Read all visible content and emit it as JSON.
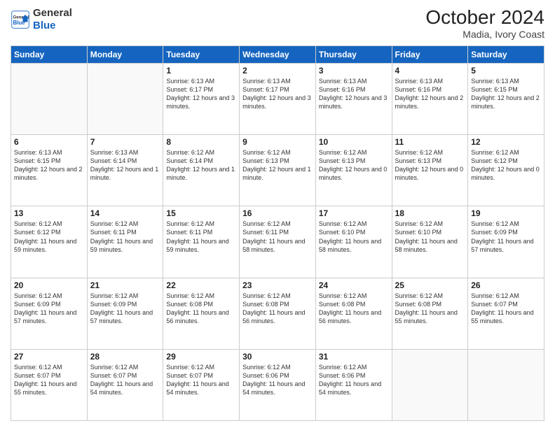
{
  "logo": {
    "general": "General",
    "blue": "Blue"
  },
  "header": {
    "month": "October 2024",
    "location": "Madia, Ivory Coast"
  },
  "days_header": [
    "Sunday",
    "Monday",
    "Tuesday",
    "Wednesday",
    "Thursday",
    "Friday",
    "Saturday"
  ],
  "weeks": [
    [
      {
        "day": "",
        "info": ""
      },
      {
        "day": "",
        "info": ""
      },
      {
        "day": "1",
        "info": "Sunrise: 6:13 AM\nSunset: 6:17 PM\nDaylight: 12 hours and 3 minutes."
      },
      {
        "day": "2",
        "info": "Sunrise: 6:13 AM\nSunset: 6:17 PM\nDaylight: 12 hours and 3 minutes."
      },
      {
        "day": "3",
        "info": "Sunrise: 6:13 AM\nSunset: 6:16 PM\nDaylight: 12 hours and 3 minutes."
      },
      {
        "day": "4",
        "info": "Sunrise: 6:13 AM\nSunset: 6:16 PM\nDaylight: 12 hours and 2 minutes."
      },
      {
        "day": "5",
        "info": "Sunrise: 6:13 AM\nSunset: 6:15 PM\nDaylight: 12 hours and 2 minutes."
      }
    ],
    [
      {
        "day": "6",
        "info": "Sunrise: 6:13 AM\nSunset: 6:15 PM\nDaylight: 12 hours and 2 minutes."
      },
      {
        "day": "7",
        "info": "Sunrise: 6:13 AM\nSunset: 6:14 PM\nDaylight: 12 hours and 1 minute."
      },
      {
        "day": "8",
        "info": "Sunrise: 6:12 AM\nSunset: 6:14 PM\nDaylight: 12 hours and 1 minute."
      },
      {
        "day": "9",
        "info": "Sunrise: 6:12 AM\nSunset: 6:13 PM\nDaylight: 12 hours and 1 minute."
      },
      {
        "day": "10",
        "info": "Sunrise: 6:12 AM\nSunset: 6:13 PM\nDaylight: 12 hours and 0 minutes."
      },
      {
        "day": "11",
        "info": "Sunrise: 6:12 AM\nSunset: 6:13 PM\nDaylight: 12 hours and 0 minutes."
      },
      {
        "day": "12",
        "info": "Sunrise: 6:12 AM\nSunset: 6:12 PM\nDaylight: 12 hours and 0 minutes."
      }
    ],
    [
      {
        "day": "13",
        "info": "Sunrise: 6:12 AM\nSunset: 6:12 PM\nDaylight: 11 hours and 59 minutes."
      },
      {
        "day": "14",
        "info": "Sunrise: 6:12 AM\nSunset: 6:11 PM\nDaylight: 11 hours and 59 minutes."
      },
      {
        "day": "15",
        "info": "Sunrise: 6:12 AM\nSunset: 6:11 PM\nDaylight: 11 hours and 59 minutes."
      },
      {
        "day": "16",
        "info": "Sunrise: 6:12 AM\nSunset: 6:11 PM\nDaylight: 11 hours and 58 minutes."
      },
      {
        "day": "17",
        "info": "Sunrise: 6:12 AM\nSunset: 6:10 PM\nDaylight: 11 hours and 58 minutes."
      },
      {
        "day": "18",
        "info": "Sunrise: 6:12 AM\nSunset: 6:10 PM\nDaylight: 11 hours and 58 minutes."
      },
      {
        "day": "19",
        "info": "Sunrise: 6:12 AM\nSunset: 6:09 PM\nDaylight: 11 hours and 57 minutes."
      }
    ],
    [
      {
        "day": "20",
        "info": "Sunrise: 6:12 AM\nSunset: 6:09 PM\nDaylight: 11 hours and 57 minutes."
      },
      {
        "day": "21",
        "info": "Sunrise: 6:12 AM\nSunset: 6:09 PM\nDaylight: 11 hours and 57 minutes."
      },
      {
        "day": "22",
        "info": "Sunrise: 6:12 AM\nSunset: 6:08 PM\nDaylight: 11 hours and 56 minutes."
      },
      {
        "day": "23",
        "info": "Sunrise: 6:12 AM\nSunset: 6:08 PM\nDaylight: 11 hours and 56 minutes."
      },
      {
        "day": "24",
        "info": "Sunrise: 6:12 AM\nSunset: 6:08 PM\nDaylight: 11 hours and 56 minutes."
      },
      {
        "day": "25",
        "info": "Sunrise: 6:12 AM\nSunset: 6:08 PM\nDaylight: 11 hours and 55 minutes."
      },
      {
        "day": "26",
        "info": "Sunrise: 6:12 AM\nSunset: 6:07 PM\nDaylight: 11 hours and 55 minutes."
      }
    ],
    [
      {
        "day": "27",
        "info": "Sunrise: 6:12 AM\nSunset: 6:07 PM\nDaylight: 11 hours and 55 minutes."
      },
      {
        "day": "28",
        "info": "Sunrise: 6:12 AM\nSunset: 6:07 PM\nDaylight: 11 hours and 54 minutes."
      },
      {
        "day": "29",
        "info": "Sunrise: 6:12 AM\nSunset: 6:07 PM\nDaylight: 11 hours and 54 minutes."
      },
      {
        "day": "30",
        "info": "Sunrise: 6:12 AM\nSunset: 6:06 PM\nDaylight: 11 hours and 54 minutes."
      },
      {
        "day": "31",
        "info": "Sunrise: 6:12 AM\nSunset: 6:06 PM\nDaylight: 11 hours and 54 minutes."
      },
      {
        "day": "",
        "info": ""
      },
      {
        "day": "",
        "info": ""
      }
    ]
  ]
}
